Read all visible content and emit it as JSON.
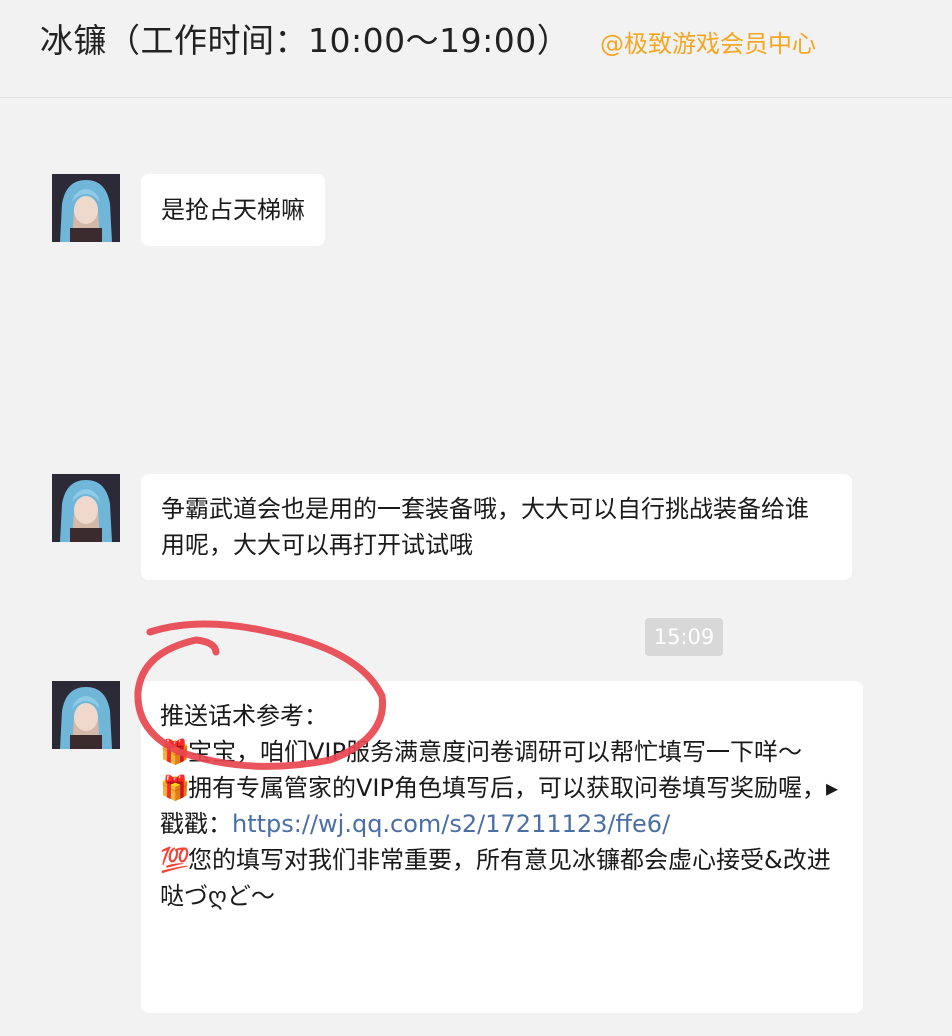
{
  "header": {
    "title": "冰镰（工作时间：10:00～19:00）",
    "org": "@极致游戏会员中心",
    "org_color": "#f5a623"
  },
  "messages": [
    {
      "text": "是抢占天梯嘛"
    },
    {
      "text": "争霸武道会也是用的一套装备哦，大大可以自行挑战装备给谁用呢，大大可以再打开试试哦"
    },
    {
      "lines": [
        {
          "text": "推送话术参考："
        },
        {
          "emoji": "🎁",
          "text": "宝宝，咱们VIP服务满意度问卷调研可以帮忙填写一下咩～"
        },
        {
          "emoji": "🎁",
          "text": "拥有专属管家的VIP角色填写后，可以获取问卷填写奖励喔，"
        },
        {
          "text": "▸戳戳：",
          "link": "https://wj.qq.com/s2/17211123/ffe6/"
        },
        {
          "emoji": "💯",
          "text": "您的填写对我们非常重要，所有意见冰镰都会虚心接受&改进哒づღど～"
        }
      ]
    }
  ],
  "timestamp": "15:09",
  "colors": {
    "link": "#4a6fa5",
    "annotation": "#e8474f",
    "background": "#f2f2f2"
  },
  "icons": [
    "avatar-anime-girl-icon",
    "gift-icon",
    "hundred-points-icon",
    "triangle-right-icon"
  ]
}
